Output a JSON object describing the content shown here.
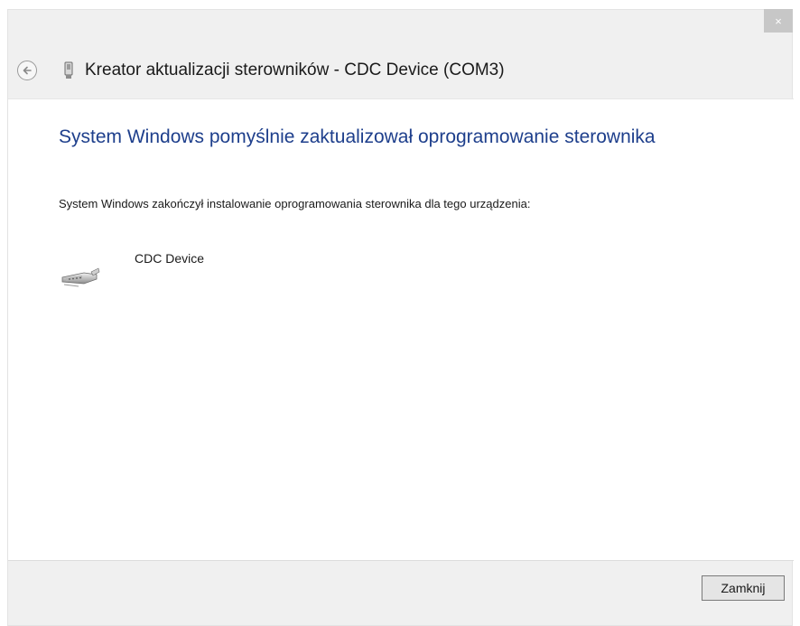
{
  "window": {
    "close_glyph": "×"
  },
  "header": {
    "title": "Kreator aktualizacji sterowników - CDC Device (COM3)",
    "back_icon": "back-arrow-icon",
    "device_icon": "usb-device-icon"
  },
  "main": {
    "heading": "System Windows pomyślnie zaktualizował oprogramowanie sterownika",
    "message": "System Windows zakończył instalowanie oprogramowania sterownika dla tego urządzenia:",
    "device": {
      "name": "CDC Device",
      "icon": "serial-port-icon"
    }
  },
  "footer": {
    "close_button_label": "Zamknij"
  },
  "colors": {
    "heading": "#1e3f8c",
    "close_tab": "#c7c7c7",
    "chrome": "#f0f0f0"
  }
}
